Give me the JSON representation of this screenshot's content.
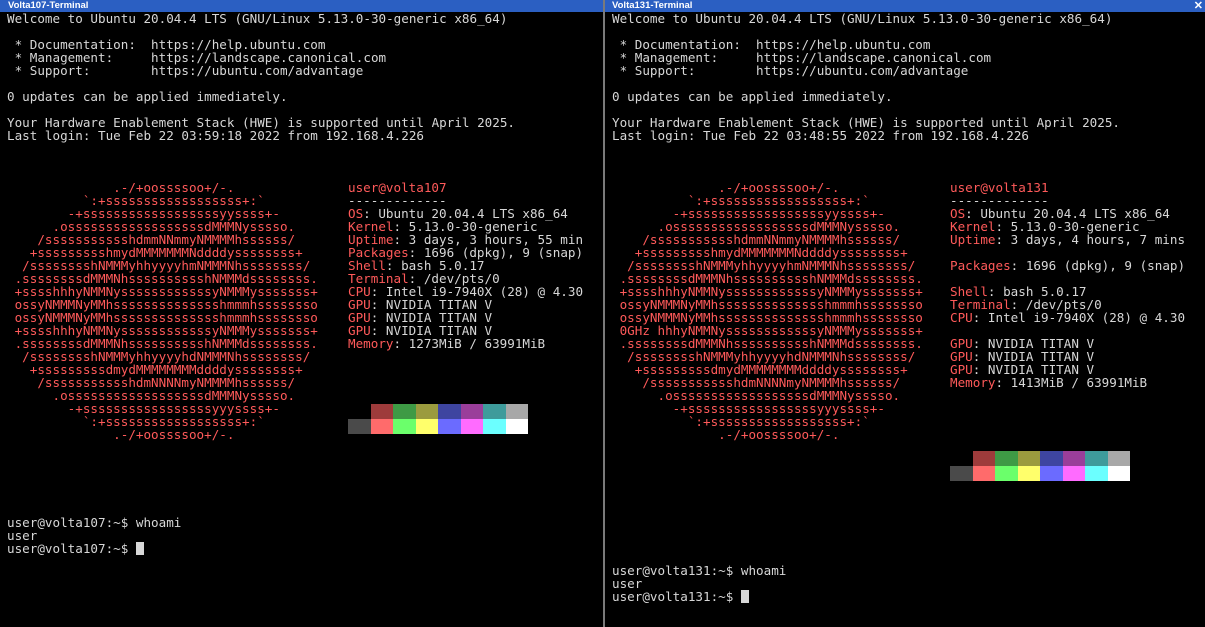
{
  "colors": {
    "titlebar": "#2b5fc2",
    "accent_red": "#ff5a5a",
    "text": "#d7d7d7",
    "background": "#000000"
  },
  "panes": [
    {
      "title": "Volta107-Terminal",
      "close_icon": "close-icon",
      "motd": [
        "Welcome to Ubuntu 20.04.4 LTS (GNU/Linux 5.13.0-30-generic x86_64)",
        "",
        " * Documentation:  https://help.ubuntu.com",
        " * Management:     https://landscape.canonical.com",
        " * Support:        https://ubuntu.com/advantage",
        "",
        "0 updates can be applied immediately.",
        "",
        "Your Hardware Enablement Stack (HWE) is supported until April 2025.",
        "Last login: Tue Feb 22 03:59:18 2022 from 192.168.4.226"
      ],
      "logo": [
        "              .-/+oossssoo+/-.",
        "          `:+ssssssssssssssssss+:`",
        "        -+ssssssssssssssssssyyssss+-",
        "      .ossssssssssssssssssdMMMNysssso.",
        "    /ssssssssssshdmmNNmmyNMMMMhssssss/",
        "   +ssssssssshmydMMMMMMMNddddyssssssss+",
        "  /sssssssshNMMMyhhyyyyhmNMMMNhssssssss/",
        " .ssssssssdMMMNhsssssssssshNMMMdssssssss.",
        " +sssshhhyNMMNyssssssssssssyNMMMysssssss+",
        " ossyNMMMNyMMhsssssssssssssshmmmhssssssso",
        " ossyNMMMNyMMhsssssssssssssshmmmhssssssso",
        " +sssshhhyNMMNyssssssssssssyNMMMysssssss+",
        " .ssssssssdMMMNhsssssssssshNMMMdssssssss.",
        "  /sssssssshNMMMyhhyyyyhdNMMMNhssssssss/",
        "   +sssssssssdmydMMMMMMMMddddyssssssss+",
        "    /ssssssssssshdmNNNNmyNMMMMhssssss/",
        "      .ossssssssssssssssssdMMMNysssso.",
        "        -+sssssssssssssssssyyyssss+-",
        "          `:+ssssssssssssssssss+:`",
        "              .-/+oossssoo+/-."
      ],
      "info": [
        {
          "key": "",
          "value": "user@volta107",
          "style": "header"
        },
        {
          "key": "",
          "value": "-------------",
          "style": "plain"
        },
        {
          "key": "OS",
          "value": ": Ubuntu 20.04.4 LTS x86_64"
        },
        {
          "key": "Kernel",
          "value": ": 5.13.0-30-generic"
        },
        {
          "key": "Uptime",
          "value": ": 3 days, 3 hours, 55 min"
        },
        {
          "key": "Packages",
          "value": ": 1696 (dpkg), 9 (snap)"
        },
        {
          "key": "Shell",
          "value": ": bash 5.0.17"
        },
        {
          "key": "Terminal",
          "value": ": /dev/pts/0"
        },
        {
          "key": "CPU",
          "value": ": Intel i9-7940X (28) @ 4.30"
        },
        {
          "key": "GPU",
          "value": ": NVIDIA TITAN V"
        },
        {
          "key": "GPU",
          "value": ": NVIDIA TITAN V"
        },
        {
          "key": "GPU",
          "value": ": NVIDIA TITAN V"
        },
        {
          "key": "Memory",
          "value": ": 1273MiB / 63991MiB"
        }
      ],
      "prompt_lines": [
        "user@volta107:~$ whoami",
        "user"
      ],
      "current_prompt": "user@volta107:~$ "
    },
    {
      "title": "Volta131-Terminal",
      "close_icon": "close-icon",
      "motd": [
        "Welcome to Ubuntu 20.04.4 LTS (GNU/Linux 5.13.0-30-generic x86_64)",
        "",
        " * Documentation:  https://help.ubuntu.com",
        " * Management:     https://landscape.canonical.com",
        " * Support:        https://ubuntu.com/advantage",
        "",
        "0 updates can be applied immediately.",
        "",
        "Your Hardware Enablement Stack (HWE) is supported until April 2025.",
        "Last login: Tue Feb 22 03:48:55 2022 from 192.168.4.226"
      ],
      "logo": [
        "              .-/+oossssoo+/-.",
        "          `:+ssssssssssssssssss+:`",
        "        -+ssssssssssssssssssyyssss+-",
        "      .ossssssssssssssssssdMMMNysssso.",
        "    /ssssssssssshdmmNNmmyNMMMMhssssss/",
        "   +ssssssssshmydMMMMMMMNddddyssssssss+",
        "  /sssssssshNMMMyhhyyyyhmNMMMNhssssssss/",
        " .ssssssssdMMMNhsssssssssshNMMMdssssssss.",
        " +sssshhhyNMMNyssssssssssssyNMMMysssssss+",
        " ossyNMMMNyMMhsssssssssssssshmmmhssssssso",
        " ossyNMMMNyMMhsssssssssssssshmmmhssssssso",
        " 0GHz hhhyNMMNyssssssssssssyNMMMysssssss+",
        " .ssssssssdMMMNhsssssssssshNMMMdssssssss.",
        "  /sssssssshNMMMyhhyyyyhdNMMMNhssssssss/",
        "   +sssssssssdmydMMMMMMMMddddyssssssss+",
        "    /ssssssssssshdmNNNNmyNMMMMhssssss/",
        "      .ossssssssssssssssssdMMMNysssso.",
        "        -+sssssssssssssssssyyyssss+-",
        "          `:+ssssssssssssssssss+:`",
        "              .-/+oossssoo+/-."
      ],
      "info": [
        {
          "key": "",
          "value": "user@volta131",
          "style": "header"
        },
        {
          "key": "",
          "value": "-------------",
          "style": "plain"
        },
        {
          "key": "OS",
          "value": ": Ubuntu 20.04.4 LTS x86_64"
        },
        {
          "key": "Kernel",
          "value": ": 5.13.0-30-generic"
        },
        {
          "key": "Uptime",
          "value": ": 3 days, 4 hours, 7 mins"
        },
        {
          "key": "",
          "value": "",
          "style": "plain"
        },
        {
          "key": "Packages",
          "value": ": 1696 (dpkg), 9 (snap)"
        },
        {
          "key": "",
          "value": "",
          "style": "plain"
        },
        {
          "key": "Shell",
          "value": ": bash 5.0.17"
        },
        {
          "key": "Terminal",
          "value": ": /dev/pts/0"
        },
        {
          "key": "CPU",
          "value": ": Intel i9-7940X (28) @ 4.30"
        },
        {
          "key": "",
          "value": "",
          "style": "plain"
        },
        {
          "key": "GPU",
          "value": ": NVIDIA TITAN V"
        },
        {
          "key": "GPU",
          "value": ": NVIDIA TITAN V"
        },
        {
          "key": "GPU",
          "value": ": NVIDIA TITAN V"
        },
        {
          "key": "Memory",
          "value": ": 1413MiB / 63991MiB"
        }
      ],
      "prompt_lines": [
        "user@volta131:~$ whoami",
        "user"
      ],
      "current_prompt": "user@volta131:~$ "
    }
  ],
  "palette": {
    "top": [
      "#000000",
      "#9e3b3b",
      "#3e9a45",
      "#9b9b3e",
      "#3e45a0",
      "#9a3e9a",
      "#3e9b9b",
      "#a8a8a8"
    ],
    "bottom": [
      "#4a4a4a",
      "#ff6b6b",
      "#6bff6b",
      "#ffff6b",
      "#6b6bff",
      "#ff6bff",
      "#6bffff",
      "#ffffff"
    ]
  }
}
